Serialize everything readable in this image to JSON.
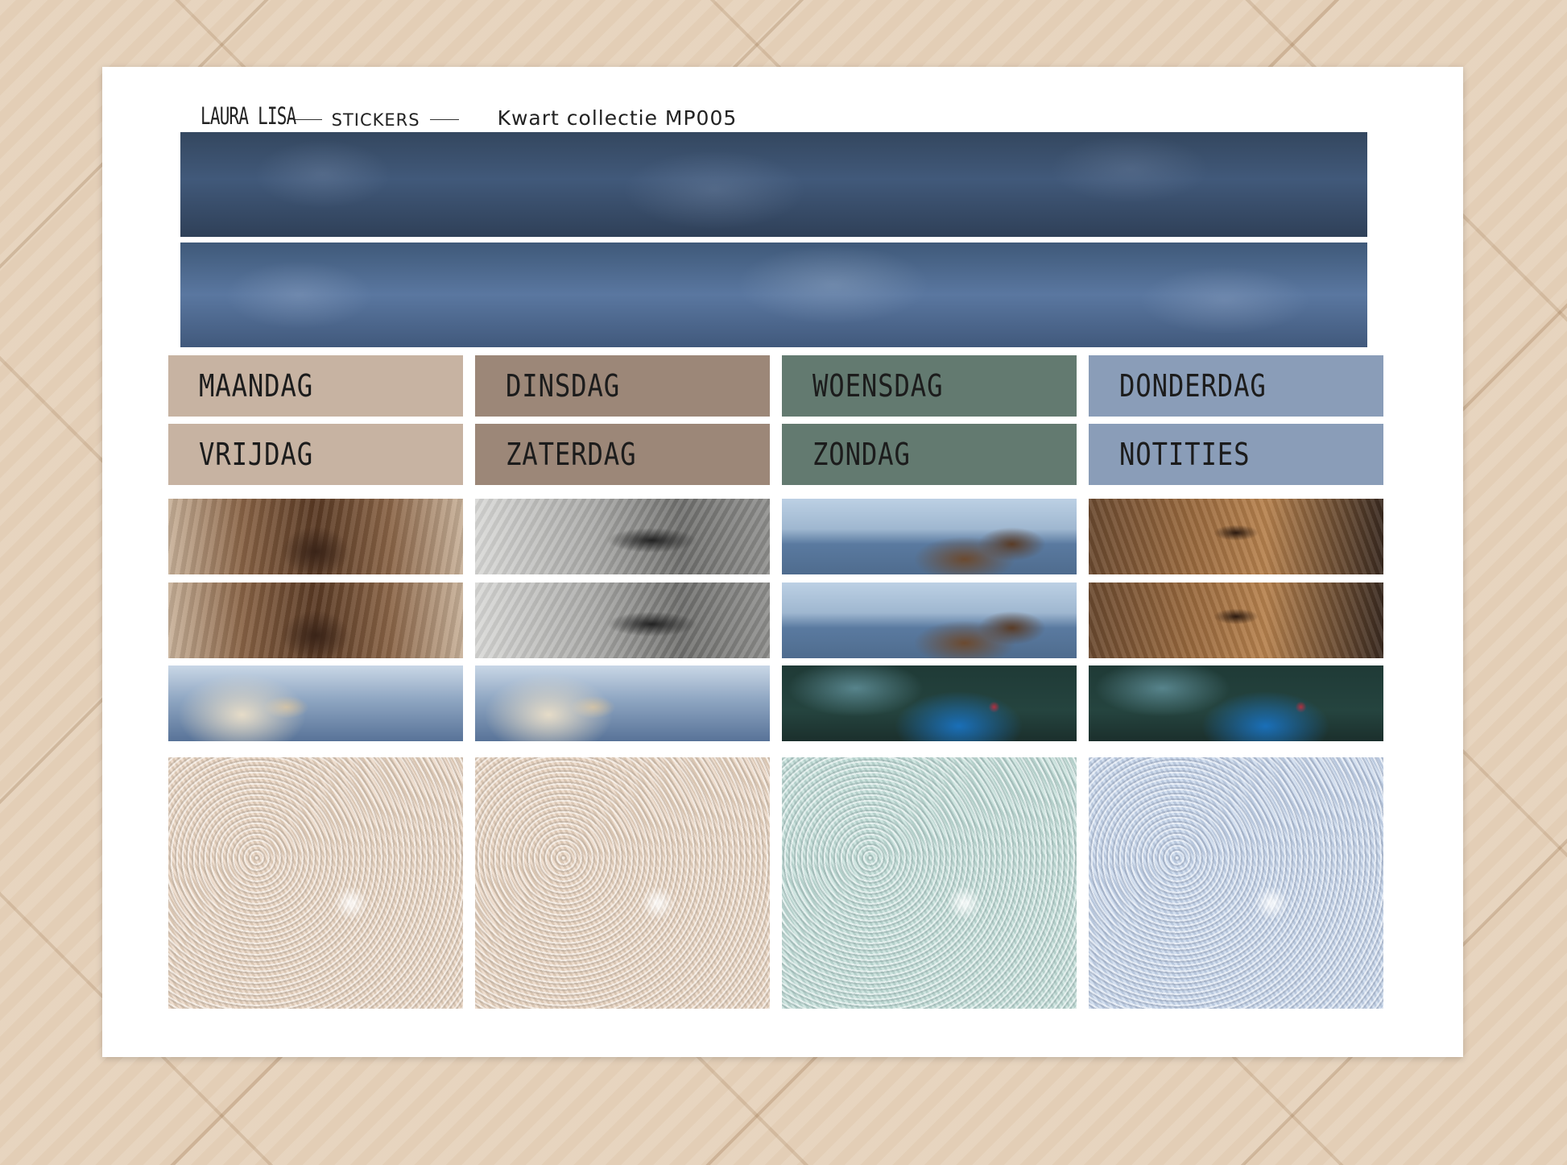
{
  "header": {
    "brand": "LAURA LISA",
    "subtitle": "STICKERS",
    "collection": "Kwart collectie MP005"
  },
  "colors": {
    "beige": "#c7b3a2",
    "taupe": "#9c8778",
    "green": "#637a70",
    "blue": "#8a9db8"
  },
  "labels": [
    "MAANDAG",
    "DINSDAG",
    "WOENSDAG",
    "DONDERDAG",
    "VRIJDAG",
    "ZATERDAG",
    "ZONDAG",
    "NOTITIES"
  ],
  "photos": [
    [
      "highland-cow",
      "grey-horse-eye",
      "deer",
      "brown-fur"
    ],
    [
      "highland-cow",
      "grey-horse-eye",
      "deer",
      "brown-fur"
    ],
    [
      "white-dog",
      "white-dog",
      "blue-bird",
      "blue-bird"
    ]
  ],
  "glitter": [
    "beige-glitter",
    "beige-glitter",
    "mint-glitter",
    "blue-glitter"
  ]
}
